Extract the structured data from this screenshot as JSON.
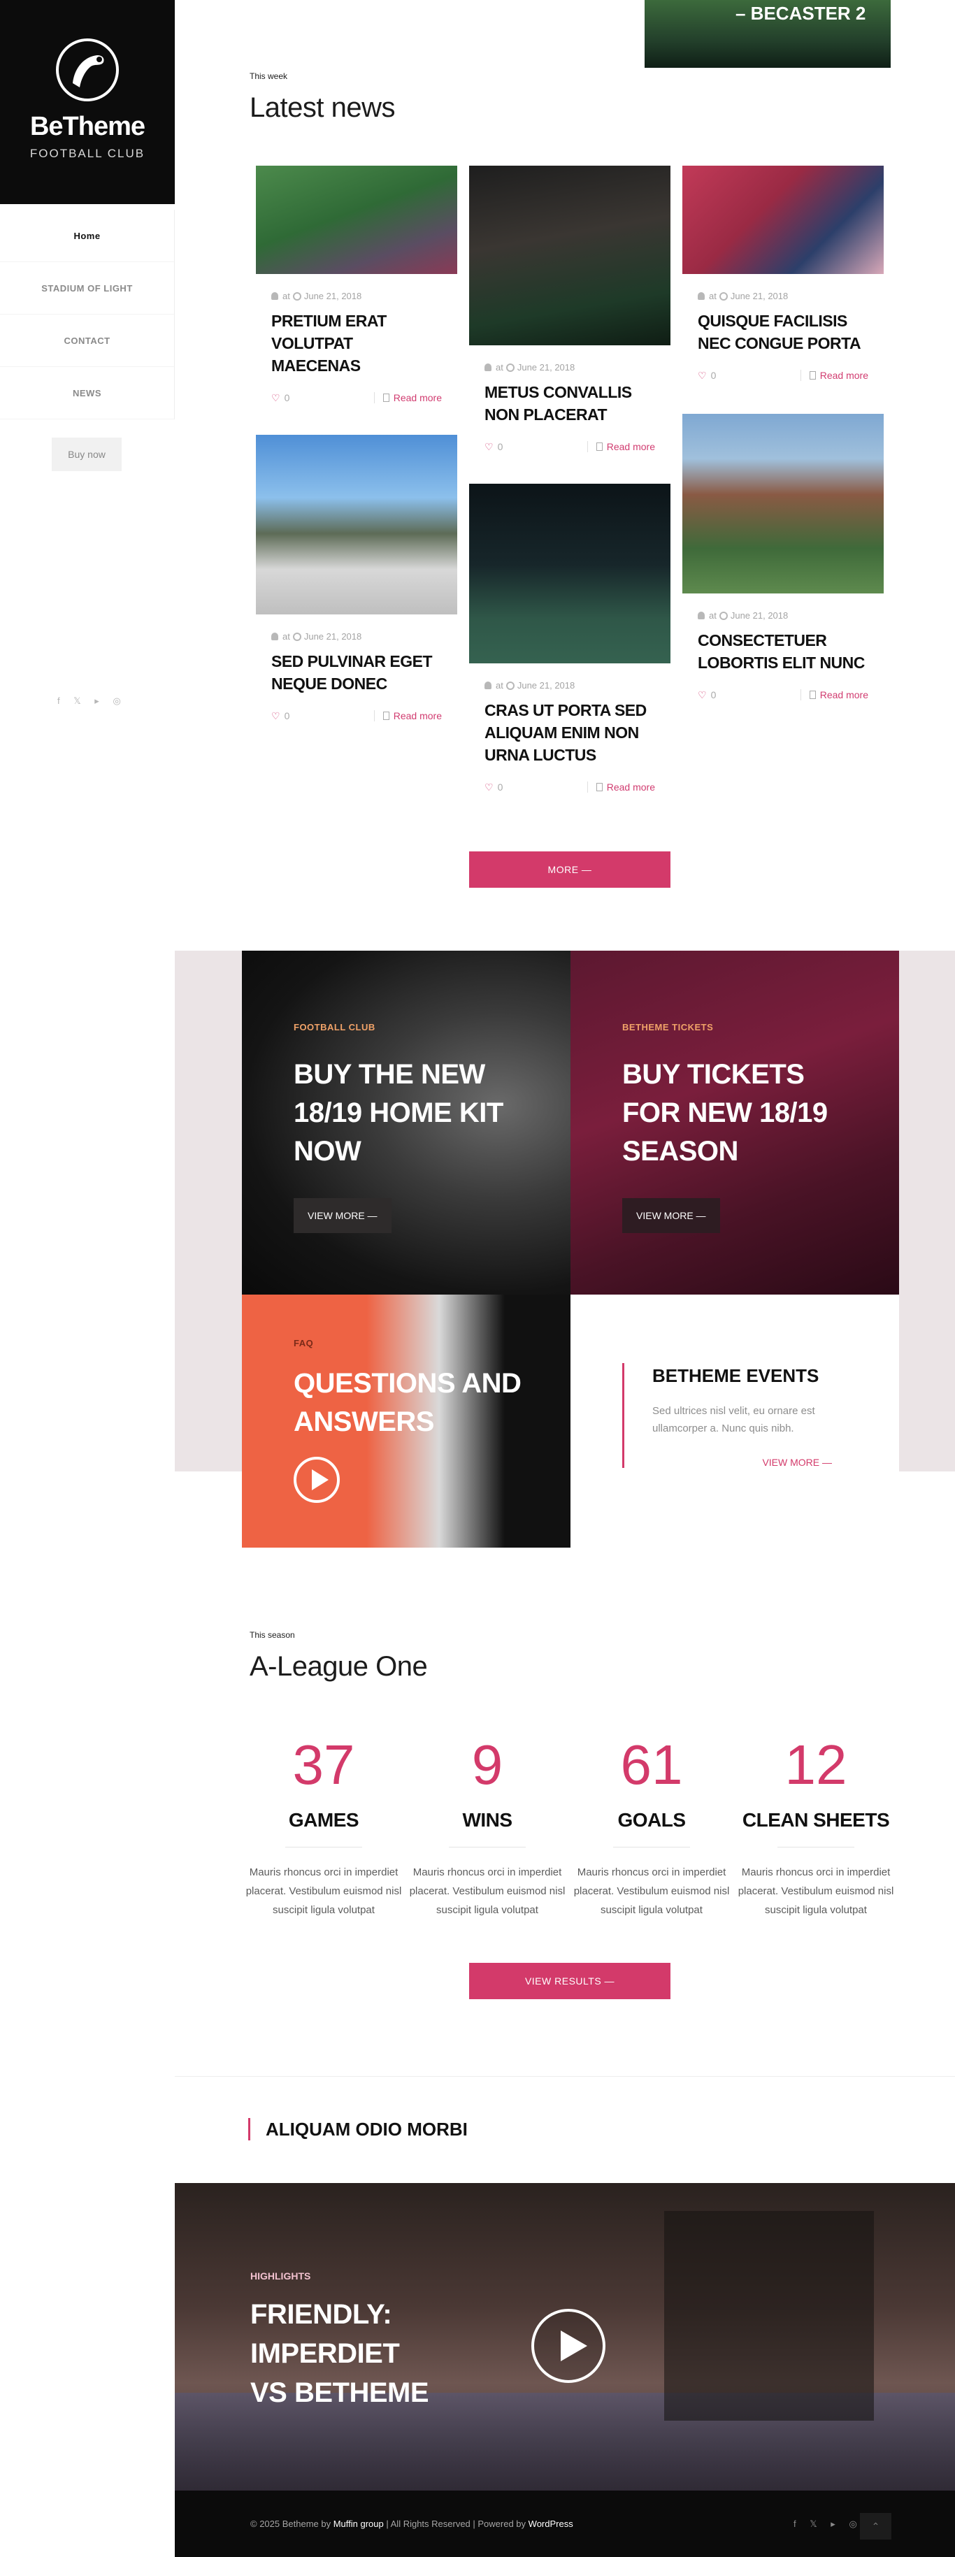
{
  "brand": {
    "title": "BeTheme",
    "subtitle": "FOOTBALL CLUB"
  },
  "menu": [
    {
      "label": "Home"
    },
    {
      "label": "STADIUM OF LIGHT"
    },
    {
      "label": "CONTACT"
    },
    {
      "label": "NEWS"
    }
  ],
  "buy_now": "Buy now",
  "social_icons": "f 𝕏 ▸ ◎",
  "hero_top_text": "– BECASTER 2",
  "news": {
    "eyebrow": "This week",
    "title": "Latest news",
    "date": "June 21, 2018",
    "at": "at",
    "read_more": "Read more",
    "more_button": "MORE —",
    "items": [
      {
        "title": "PRETIUM ERAT VOLUTPAT MAECENAS",
        "likes": "0"
      },
      {
        "title": "METUS CONVALLIS NON PLACERAT",
        "likes": "0"
      },
      {
        "title": "QUISQUE FACILISIS NEC CONGUE PORTA",
        "likes": "0"
      },
      {
        "title": "SED PULVINAR EGET NEQUE DONEC",
        "likes": "0"
      },
      {
        "title": "CRAS UT PORTA SED ALIQUAM ENIM NON URNA LUCTUS",
        "likes": "0"
      },
      {
        "title": "CONSECTETUER LOBORTIS ELIT NUNC",
        "likes": "0"
      }
    ]
  },
  "promos": {
    "kit": {
      "tag": "FOOTBALL CLUB",
      "title": "BUY THE NEW 18/19 HOME KIT NOW",
      "button": "VIEW MORE —"
    },
    "tickets": {
      "tag": "BETHEME TICKETS",
      "title": "BUY TICKETS FOR NEW 18/19 SEASON",
      "button": "VIEW MORE —"
    },
    "faq": {
      "tag": "FAQ",
      "title": "QUESTIONS AND ANSWERS"
    },
    "events": {
      "title": "BETHEME EVENTS",
      "desc": "Sed ultrices nisl velit, eu ornare est ullamcorper a. Nunc quis nibh.",
      "link": "VIEW MORE —"
    }
  },
  "season": {
    "eyebrow": "This season",
    "title": "A-League One",
    "stats": [
      {
        "value": "37",
        "label": "GAMES",
        "desc": "Mauris rhoncus orci in imperdiet placerat. Vestibulum euismod nisl suscipit ligula volutpat"
      },
      {
        "value": "9",
        "label": "WINS",
        "desc": "Mauris rhoncus orci in imperdiet placerat. Vestibulum euismod nisl suscipit ligula volutpat"
      },
      {
        "value": "61",
        "label": "GOALS",
        "desc": "Mauris rhoncus orci in imperdiet placerat. Vestibulum euismod nisl suscipit ligula volutpat"
      },
      {
        "value": "12",
        "label": "CLEAN SHEETS",
        "desc": "Mauris rhoncus orci in imperdiet placerat. Vestibulum euismod nisl suscipit ligula volutpat"
      }
    ],
    "results_button": "VIEW RESULTS —"
  },
  "aliquam_heading": "ALIQUAM ODIO MORBI",
  "highlights": {
    "tag": "HIGHLIGHTS",
    "title_line1": "FRIENDLY:",
    "title_line2": "IMPERDIET",
    "title_line3": "VS BETHEME"
  },
  "footer": {
    "prefix": "© 2025 Betheme by ",
    "brand": "Muffin group",
    "middle": " | All Rights Reserved | Powered by ",
    "wp": "WordPress",
    "social": "f 𝕏 ▸ ◎",
    "up": "⌃"
  }
}
